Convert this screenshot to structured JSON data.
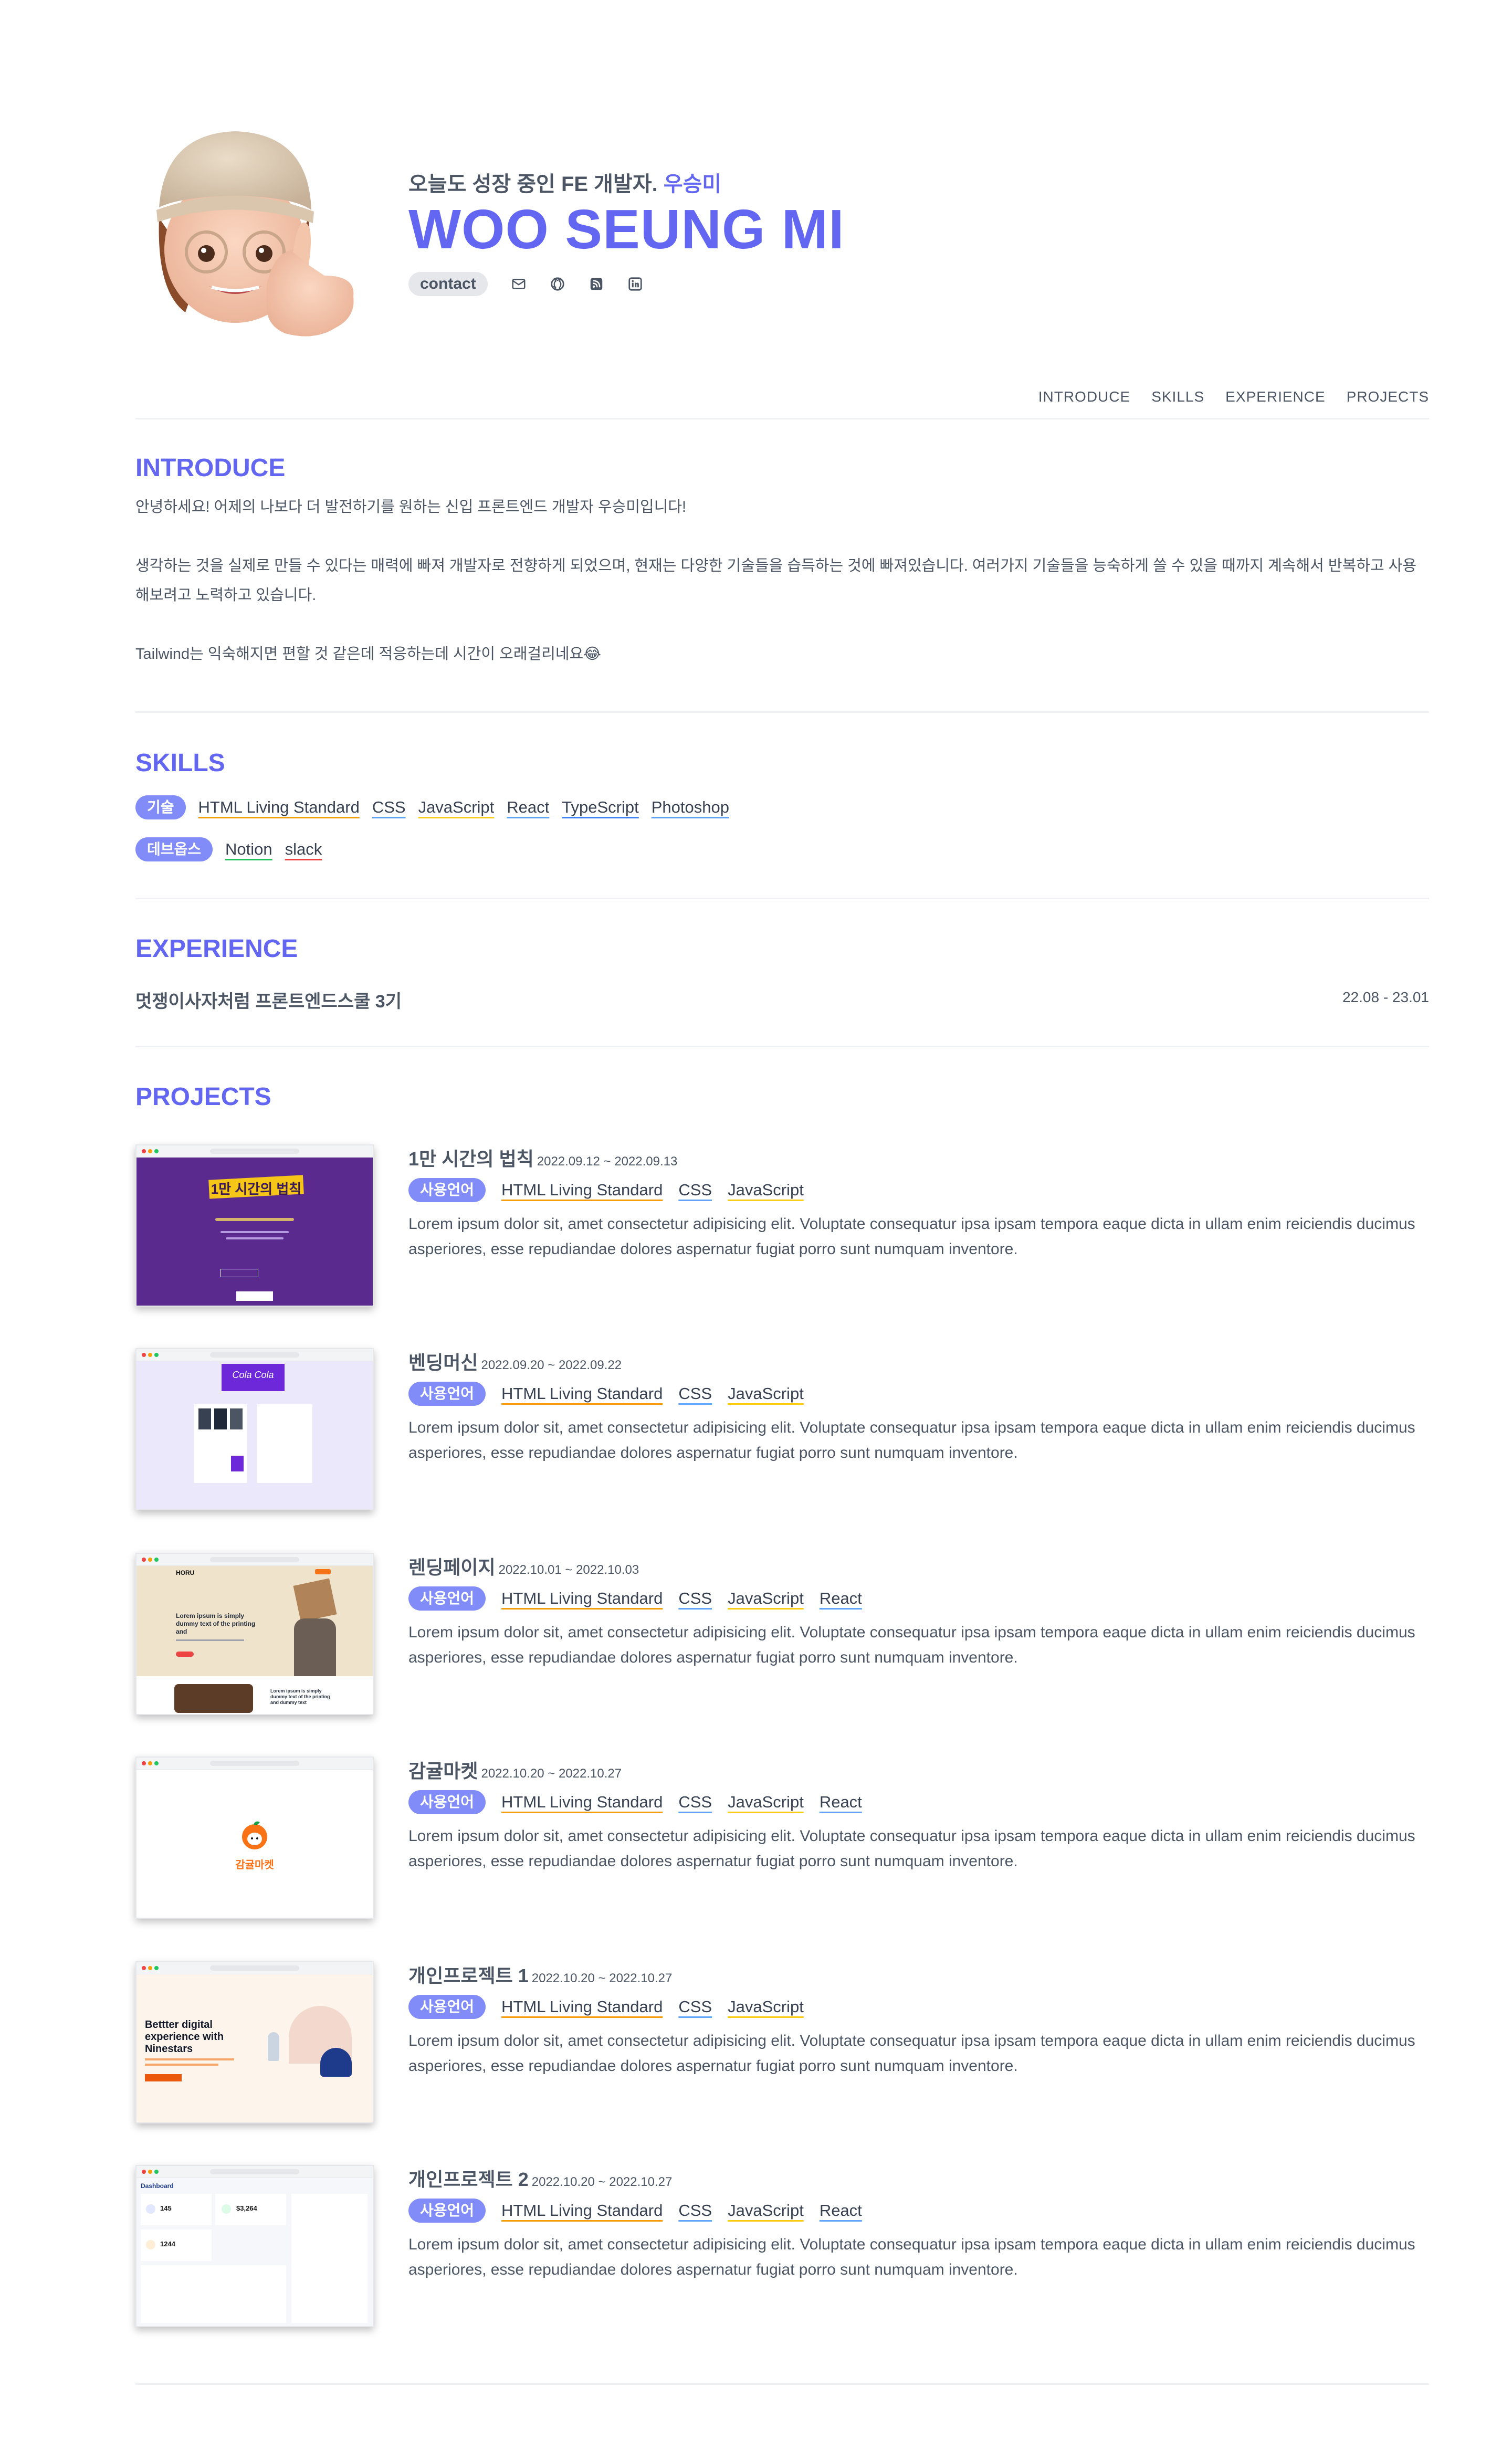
{
  "header": {
    "subtitle_prefix": "오늘도 성장 중인 FE 개발자.",
    "subtitle_name": "우승미",
    "title": "WOO SEUNG MI",
    "contact_label": "contact",
    "icons": [
      "mail-icon",
      "github-icon",
      "rss-icon",
      "linkedin-icon"
    ]
  },
  "nav": {
    "items": [
      "INTRODUCE",
      "SKILLS",
      "EXPERIENCE",
      "PROJECTS"
    ]
  },
  "introduce": {
    "title": "INTRODUCE",
    "p1": "안녕하세요! 어제의 나보다 더 발전하기를 원하는 신입 프론트엔드 개발자 우승미입니다!",
    "p2": "생각하는 것을 실제로 만들 수 있다는 매력에 빠져 개발자로 전향하게 되었으며, 현재는 다양한 기술들을 습득하는 것에 빠져있습니다. 여러가지 기술들을 능숙하게 쓸 수 있을 때까지 계속해서 반복하고 사용해보려고 노력하고 있습니다.",
    "p3": "Tailwind는 익숙해지면 편할 것 같은데 적응하는데 시간이 오래걸리네요😂"
  },
  "skills": {
    "title": "SKILLS",
    "tech_label": "기술",
    "tech": [
      "HTML Living Standard",
      "CSS",
      "JavaScript",
      "React",
      "TypeScript",
      "Photoshop"
    ],
    "devops_label": "데브옵스",
    "devops": [
      "Notion",
      "slack"
    ]
  },
  "experience": {
    "title": "EXPERIENCE",
    "name": "멋쟁이사자처럼 프론트엔드스쿨 3기",
    "date": "22.08 - 23.01"
  },
  "projects": {
    "title": "PROJECTS",
    "tag_label": "사용언어",
    "desc": "Lorem ipsum dolor sit, amet consectetur adipisicing elit. Voluptate consequatur ipsa ipsam tempora eaque dicta in ullam enim reiciendis ducimus asperiores, esse repudiandae dolores aspernatur fugiat porro sunt numquam inventore.",
    "items": [
      {
        "name": "1만 시간의 법칙",
        "date": "2022.09.12 ~ 2022.09.13",
        "tags": [
          "HTML Living Standard",
          "CSS",
          "JavaScript"
        ]
      },
      {
        "name": "벤딩머신",
        "date": "2022.09.20 ~ 2022.09.22",
        "tags": [
          "HTML Living Standard",
          "CSS",
          "JavaScript"
        ]
      },
      {
        "name": "렌딩페이지",
        "date": "2022.10.01 ~ 2022.10.03",
        "tags": [
          "HTML Living Standard",
          "CSS",
          "JavaScript",
          "React"
        ]
      },
      {
        "name": "감귤마켓",
        "date": "2022.10.20 ~ 2022.10.27",
        "tags": [
          "HTML Living Standard",
          "CSS",
          "JavaScript",
          "React"
        ]
      },
      {
        "name": "개인프로젝트 1",
        "date": "2022.10.20 ~ 2022.10.27",
        "tags": [
          "HTML Living Standard",
          "CSS",
          "JavaScript"
        ]
      },
      {
        "name": "개인프로젝트 2",
        "date": "2022.10.20 ~ 2022.10.27",
        "tags": [
          "HTML Living Standard",
          "CSS",
          "JavaScript",
          "React"
        ]
      }
    ],
    "thumb_texts": {
      "p1_title": "1만 시간의 법칙",
      "p2_logo": "Cola Cola",
      "p3_brand": "HORU",
      "p3_heading": "Lorem ipsum is simply dummy text of the printing and",
      "p3_heading2": "Lorem ipsum is simply dummy text of the printing and dummy text",
      "p4_name": "감귤마켓",
      "p5_heading": "Bettter digital experience with Ninestars",
      "p6_dashboard": "Dashboard",
      "p6_v1": "145",
      "p6_v2": "$3,264",
      "p6_v3": "1244"
    }
  },
  "colors": {
    "accent": "#6366f1",
    "pill": "#818cf8",
    "text": "#4b5563",
    "underline_colors": [
      "#f59e0b",
      "#60a5fa",
      "#facc15",
      "#60a5fa",
      "#3b82f6",
      "#60a5fa",
      "#22c55e",
      "#ef4444"
    ]
  }
}
